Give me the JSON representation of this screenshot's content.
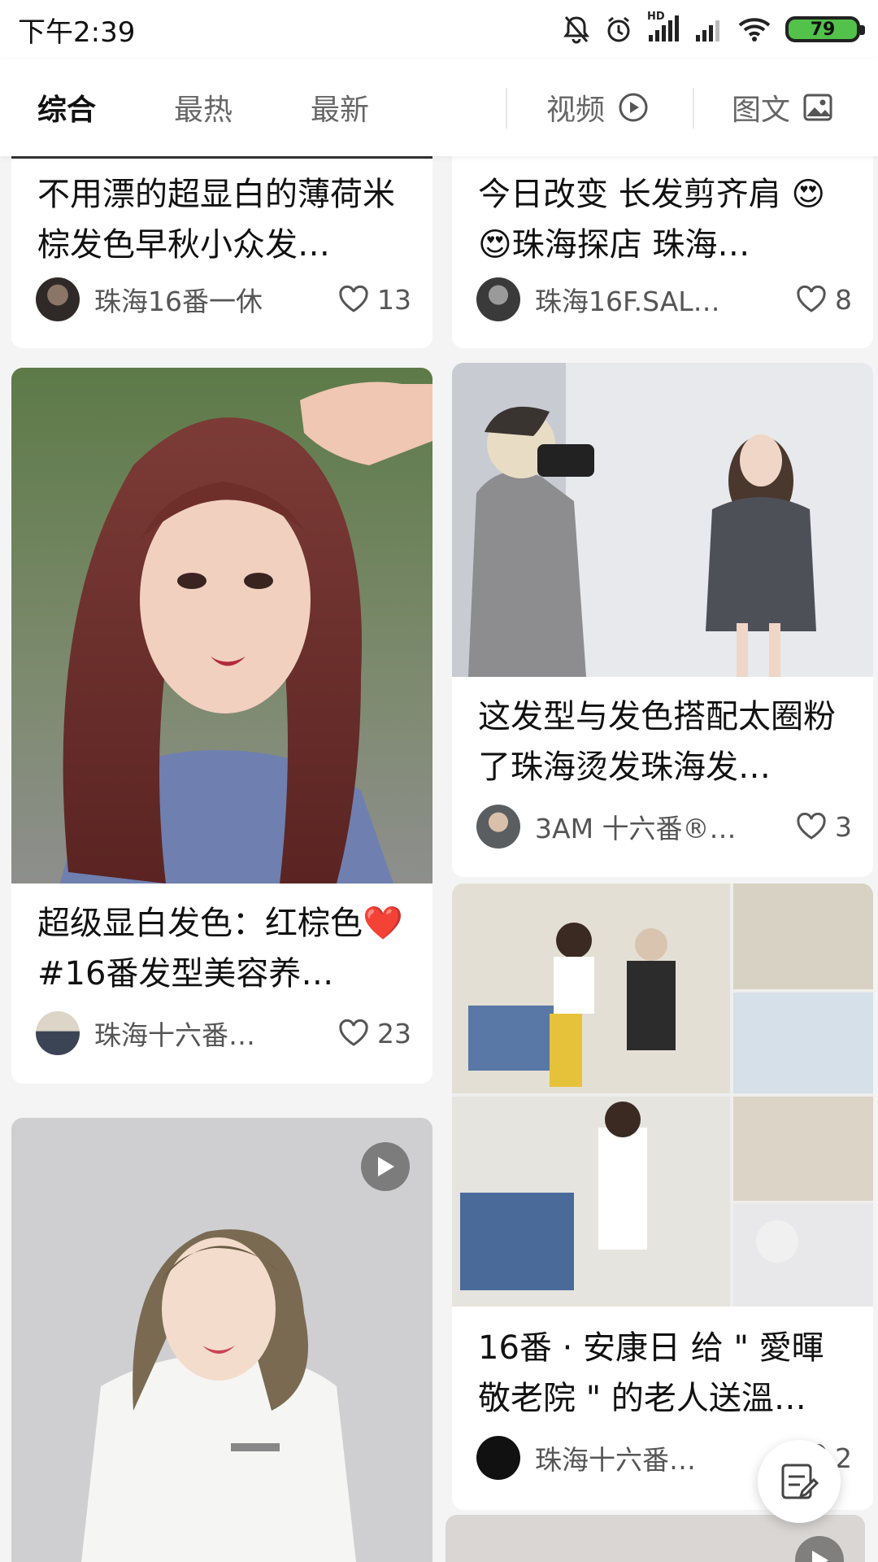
{
  "status": {
    "time": "下午2:39",
    "battery": "79",
    "hd": "HD"
  },
  "tabs": {
    "comprehensive": "综合",
    "hottest": "最热",
    "newest": "最新",
    "video": "视频",
    "text_image": "图文"
  },
  "cards": {
    "c1": {
      "title": "不用漂的超显白的薄荷米棕发色早秋小众发…",
      "author": "珠海16番一休",
      "likes": "13"
    },
    "c2": {
      "title": "今日改变 长发剪齐肩 😍😍珠海探店 珠海…",
      "author": "珠海16F.SAL…",
      "likes": "8"
    },
    "c3": {
      "title": "超级显白发色：红棕色❤️ #16番发型美容养…",
      "author": "珠海十六番…",
      "likes": "23"
    },
    "c4": {
      "title": "这发型与发色搭配太圈粉了珠海烫发珠海发…",
      "author": "3AM 十六番®…",
      "likes": "3"
    },
    "c5": {
      "title": "16番 · 安康日 给 \" 愛暉敬老院 \" 的老人送溫…",
      "author": "珠海十六番…",
      "likes": "2"
    }
  },
  "icons": {
    "mute": "bell-off-icon",
    "alarm": "alarm-icon",
    "signal": "signal-icon",
    "wifi": "wifi-icon",
    "video": "play-circle-icon",
    "image": "image-icon",
    "heart": "heart-outline-icon",
    "compose": "compose-icon"
  },
  "colors": {
    "battery": "#52c24a",
    "title": "#111111",
    "meta": "#555555"
  }
}
